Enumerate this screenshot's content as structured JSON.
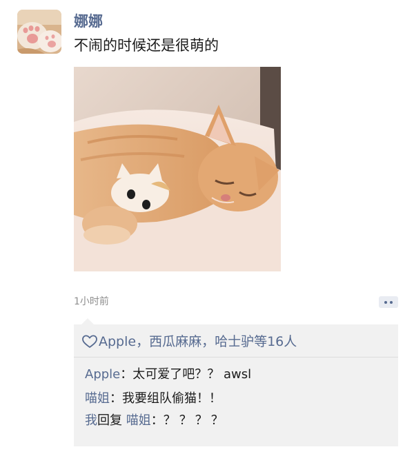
{
  "post": {
    "username": "娜娜",
    "text": "不闹的时候还是很萌的",
    "timestamp": "1小时前"
  },
  "icons": {
    "avatar": "cat-paw-avatar",
    "more": "more-dots-icon",
    "heart": "heart-outline-icon"
  },
  "likes": {
    "text": "Apple，西瓜麻麻，哈士驴等16人"
  },
  "comments": [
    {
      "author": "Apple",
      "sep": "：",
      "text": "太可爱了吧？？ awsl"
    },
    {
      "author": "喵姐",
      "sep": "：",
      "text": "我要组队偷猫！！"
    },
    {
      "author": "我",
      "action": "回复",
      "target": "喵姐",
      "sep": "：",
      "text": "？？？？"
    }
  ],
  "colors": {
    "link": "#566a90",
    "text": "#1b1b1b",
    "muted": "#8e8e8e",
    "panel": "#f1f1f1"
  }
}
